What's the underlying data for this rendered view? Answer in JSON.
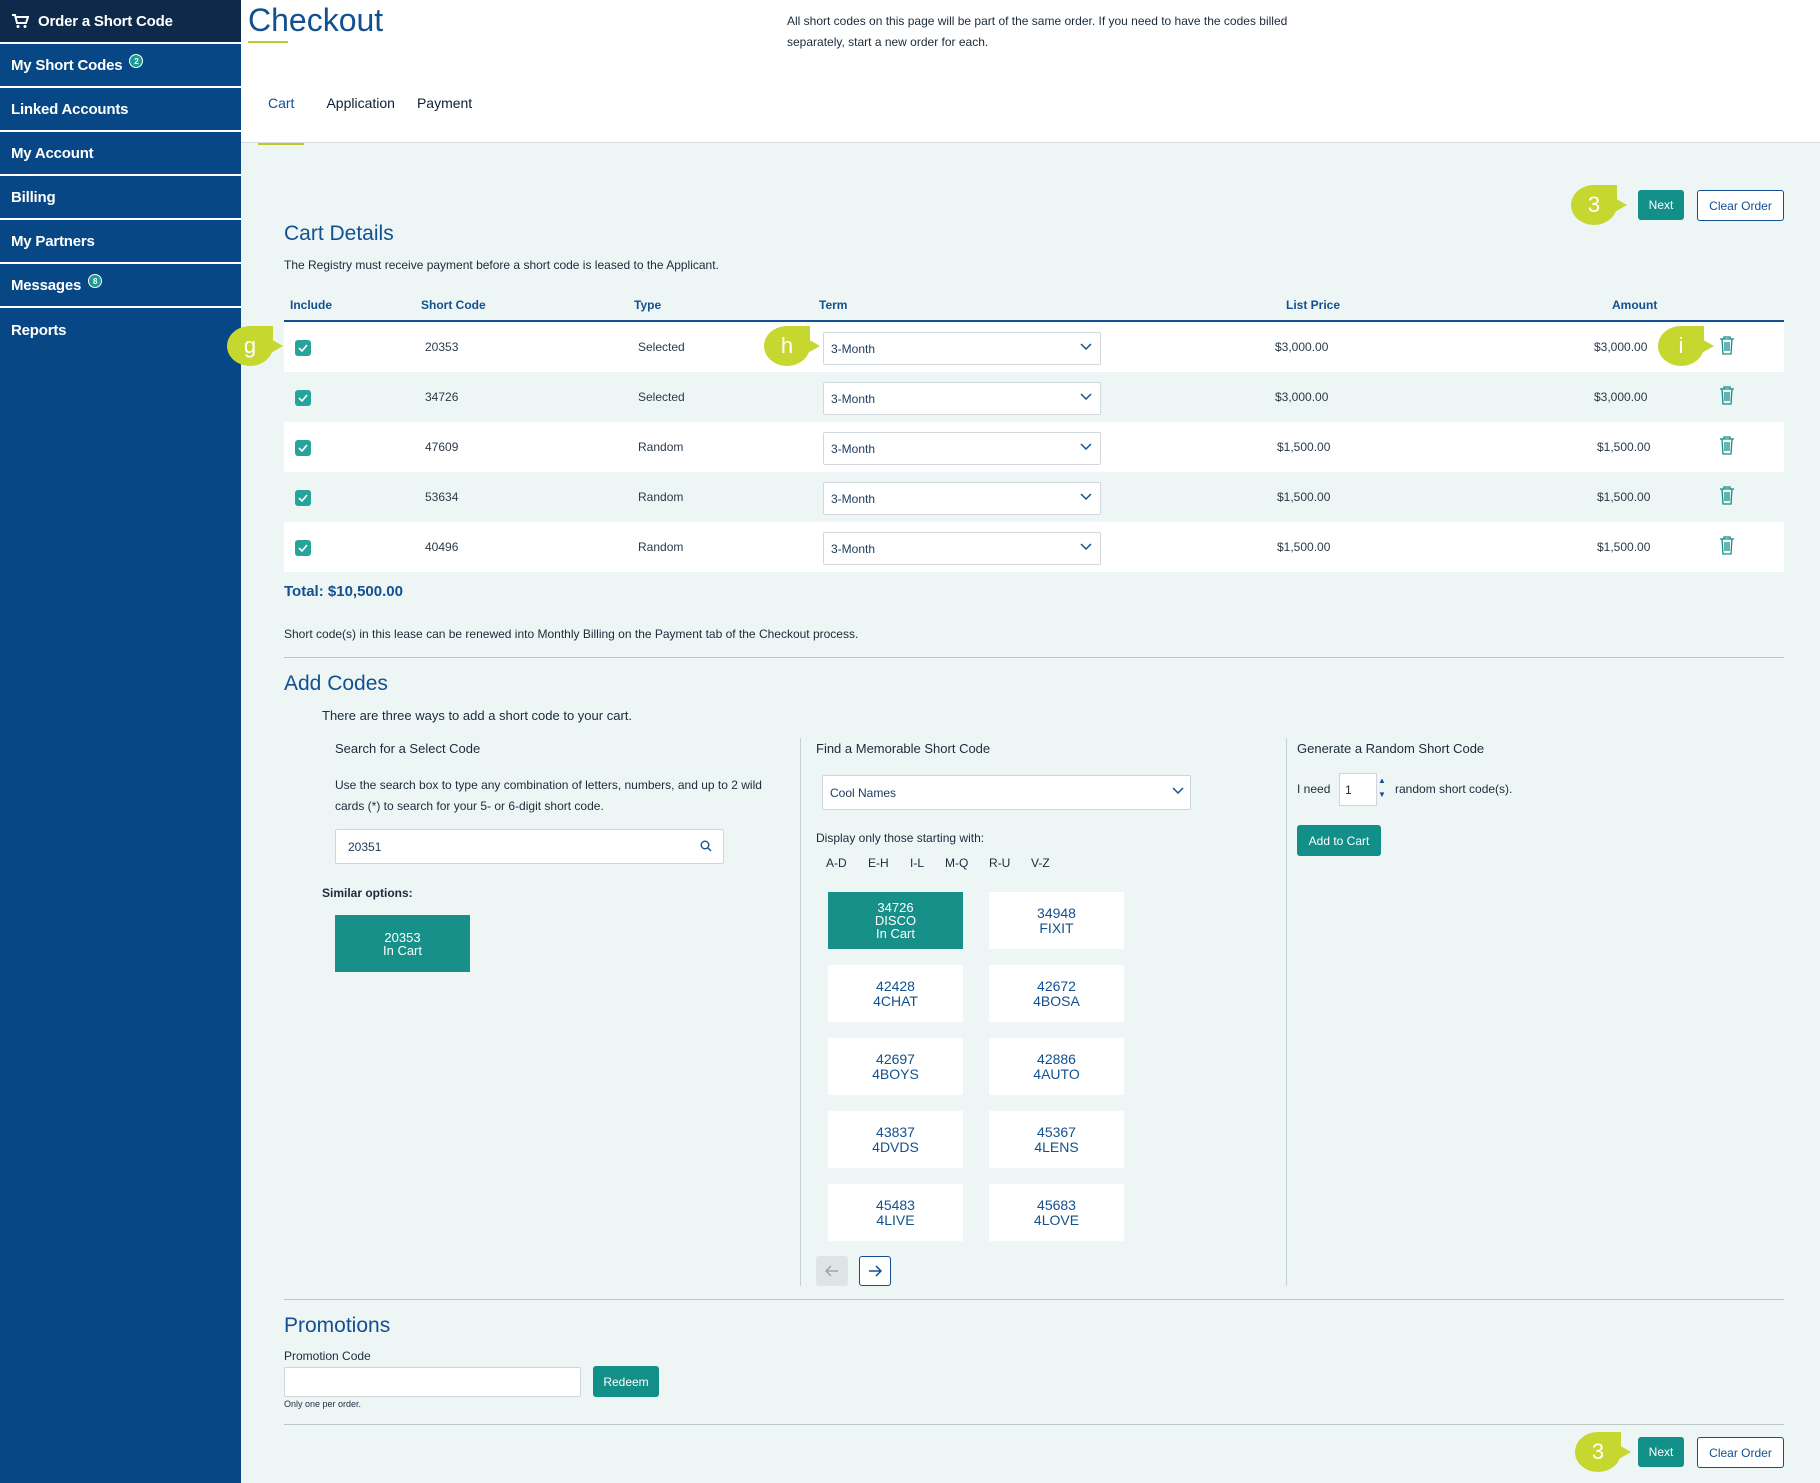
{
  "sidebar": {
    "items": [
      {
        "label": "Order a Short Code",
        "icon": "cart-icon"
      },
      {
        "label": "My Short Codes",
        "badge": "2"
      },
      {
        "label": "Linked Accounts"
      },
      {
        "label": "My Account"
      },
      {
        "label": "Billing"
      },
      {
        "label": "My Partners"
      },
      {
        "label": "Messages",
        "badge": "8"
      },
      {
        "label": "Reports"
      }
    ]
  },
  "header": {
    "title": "Checkout",
    "note": "All short codes on this page will be part of the same order. If you need to have the codes billed separately, start a new order for each.",
    "tabs": [
      "Cart",
      "Application",
      "Payment"
    ]
  },
  "actions": {
    "next_label": "Next",
    "clear_label": "Clear Order"
  },
  "callouts": {
    "top_next": "3",
    "bottom_next": "3",
    "include": "g",
    "term": "h",
    "delete": "i"
  },
  "cart": {
    "title": "Cart Details",
    "subtitle": "The Registry must receive payment before a short code is leased to the Applicant.",
    "columns": [
      "Include",
      "Short Code",
      "Type",
      "Term",
      "List Price",
      "Amount"
    ],
    "rows": [
      {
        "code": "20353",
        "type": "Selected",
        "term": "3-Month",
        "list_price": "$3,000.00",
        "amount": "$3,000.00"
      },
      {
        "code": "34726",
        "type": "Selected",
        "term": "3-Month",
        "list_price": "$3,000.00",
        "amount": "$3,000.00"
      },
      {
        "code": "47609",
        "type": "Random",
        "term": "3-Month",
        "list_price": "$1,500.00",
        "amount": "$1,500.00"
      },
      {
        "code": "53634",
        "type": "Random",
        "term": "3-Month",
        "list_price": "$1,500.00",
        "amount": "$1,500.00"
      },
      {
        "code": "40496",
        "type": "Random",
        "term": "3-Month",
        "list_price": "$1,500.00",
        "amount": "$1,500.00"
      }
    ],
    "total": "Total: $10,500.00",
    "renew_note": "Short code(s) in this lease can be renewed into Monthly Billing on the Payment tab of the Checkout process."
  },
  "add_codes": {
    "title": "Add Codes",
    "intro": "There are three ways to add a short code to your cart.",
    "search": {
      "title": "Search for a Select Code",
      "help": "Use the search box to type any combination of letters, numbers, and up to 2 wild cards (*) to search for your 5- or 6-digit short code.",
      "value": "20351",
      "similar_label": "Similar options:",
      "similar": [
        {
          "code": "20353",
          "status": "In Cart"
        }
      ]
    },
    "memorable": {
      "title": "Find a Memorable Short Code",
      "category": "Cool Names",
      "filter_label": "Display only those starting with:",
      "ranges": [
        "A-D",
        "E-H",
        "I-L",
        "M-Q",
        "R-U",
        "V-Z"
      ],
      "tiles": [
        {
          "code": "34726",
          "name": "DISCO",
          "status": "In Cart"
        },
        {
          "code": "34948",
          "name": "FIXIT",
          "status": ""
        },
        {
          "code": "42428",
          "name": "4CHAT",
          "status": ""
        },
        {
          "code": "42672",
          "name": "4BOSA",
          "status": ""
        },
        {
          "code": "42697",
          "name": "4BOYS",
          "status": ""
        },
        {
          "code": "42886",
          "name": "4AUTO",
          "status": ""
        },
        {
          "code": "43837",
          "name": "4DVDS",
          "status": ""
        },
        {
          "code": "45367",
          "name": "4LENS",
          "status": ""
        },
        {
          "code": "45483",
          "name": "4LIVE",
          "status": ""
        },
        {
          "code": "45683",
          "name": "4LOVE",
          "status": ""
        }
      ]
    },
    "random": {
      "title": "Generate a Random Short Code",
      "prefix": "I need",
      "quantity": "1",
      "suffix": "random short code(s).",
      "button": "Add to Cart"
    }
  },
  "promotions": {
    "title": "Promotions",
    "label": "Promotion Code",
    "value": "",
    "button": "Redeem",
    "note": "Only one per order."
  },
  "colors": {
    "sidebar": "#074785",
    "accent": "#138f89",
    "callout": "#c6d730",
    "heading": "#13508f"
  }
}
